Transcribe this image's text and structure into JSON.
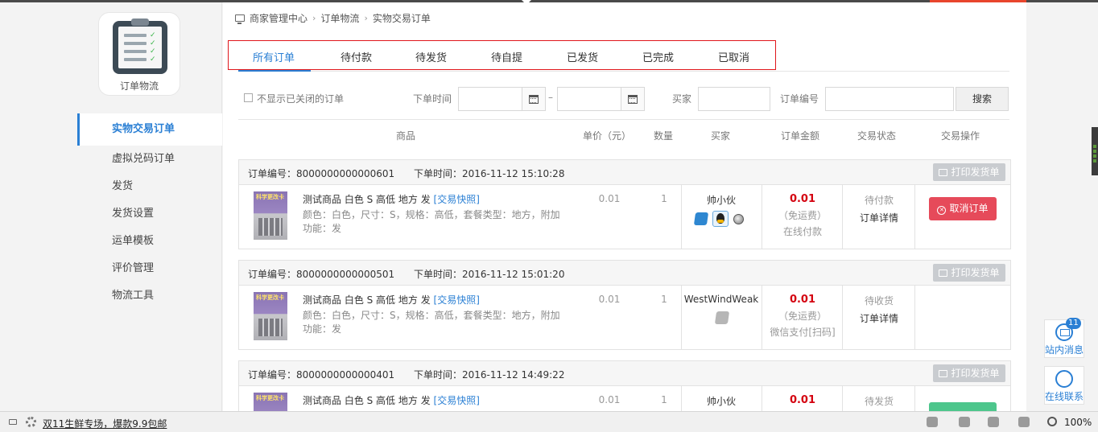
{
  "sidebar": {
    "app_label": "订单物流",
    "items": [
      {
        "label": "实物交易订单",
        "active": true
      },
      {
        "label": "虚拟兑码订单"
      },
      {
        "label": "发货"
      },
      {
        "label": "发货设置"
      },
      {
        "label": "运单模板"
      },
      {
        "label": "评价管理"
      },
      {
        "label": "物流工具"
      }
    ]
  },
  "breadcrumb": [
    "商家管理中心",
    "订单物流",
    "实物交易订单"
  ],
  "tabs": [
    "所有订单",
    "待付款",
    "待发货",
    "待自提",
    "已发货",
    "已完成",
    "已取消"
  ],
  "filters": {
    "hide_closed_label": "不显示已关闭的订单",
    "order_time_label": "下单时间",
    "range_sep": "–",
    "buyer_label": "买家",
    "order_no_label": "订单编号",
    "search_label": "搜索"
  },
  "table_headers": [
    "商品",
    "单价（元）",
    "数量",
    "买家",
    "订单金额",
    "交易状态",
    "交易操作"
  ],
  "orders": [
    {
      "order_no": "订单编号：8000000000000601",
      "order_time": "下单时间：2016-11-12 15:10:28",
      "print_label": "打印发货单",
      "thumb_text": "科学更改卡",
      "goods_name": "测试商品 白色 S 高低 地方 发",
      "snapshot": "[交易快照]",
      "attrs": "颜色：白色，尺寸：S，规格：高低，套餐类型：地方，附加功能：发",
      "price": "0.01",
      "qty": "1",
      "buyer": "帅小伙",
      "amount": "0.01",
      "freight": "（免运费）",
      "pay_method": "在线付款",
      "status": "待付款",
      "detail": "订单详情",
      "action": "取消订单"
    },
    {
      "order_no": "订单编号：8000000000000501",
      "order_time": "下单时间：2016-11-12 15:01:20",
      "print_label": "打印发货单",
      "thumb_text": "科学更改卡",
      "goods_name": "测试商品 白色 S 高低 地方 发",
      "snapshot": "[交易快照]",
      "attrs": "颜色：白色，尺寸：S，规格：高低，套餐类型：地方，附加功能：发",
      "price": "0.01",
      "qty": "1",
      "buyer": "WestWindWeak",
      "amount": "0.01",
      "freight": "（免运费）",
      "pay_method": "微信支付[扫码]",
      "status": "待收货",
      "detail": "订单详情",
      "action": ""
    },
    {
      "order_no": "订单编号：8000000000000401",
      "order_time": "下单时间：2016-11-12 14:49:22",
      "print_label": "打印发货单",
      "thumb_text": "科学更改卡",
      "goods_name": "测试商品 白色 S 高低 地方 发",
      "snapshot": "[交易快照]",
      "price": "0.01",
      "qty": "1",
      "buyer": "帅小伙",
      "amount": "0.01",
      "status": "待发货"
    }
  ],
  "float": {
    "messages_label": "站内消息",
    "messages_count": "11",
    "contact_label": "在线联系"
  },
  "statusbar": {
    "promo": "双11生鲜专场，爆款9.9包邮",
    "zoom": "100%"
  },
  "colors": {
    "accent": "#2a7fd4",
    "price_red": "#d4000f",
    "cancel_btn": "#e64a5a",
    "tab_outline": "#e0161b"
  }
}
